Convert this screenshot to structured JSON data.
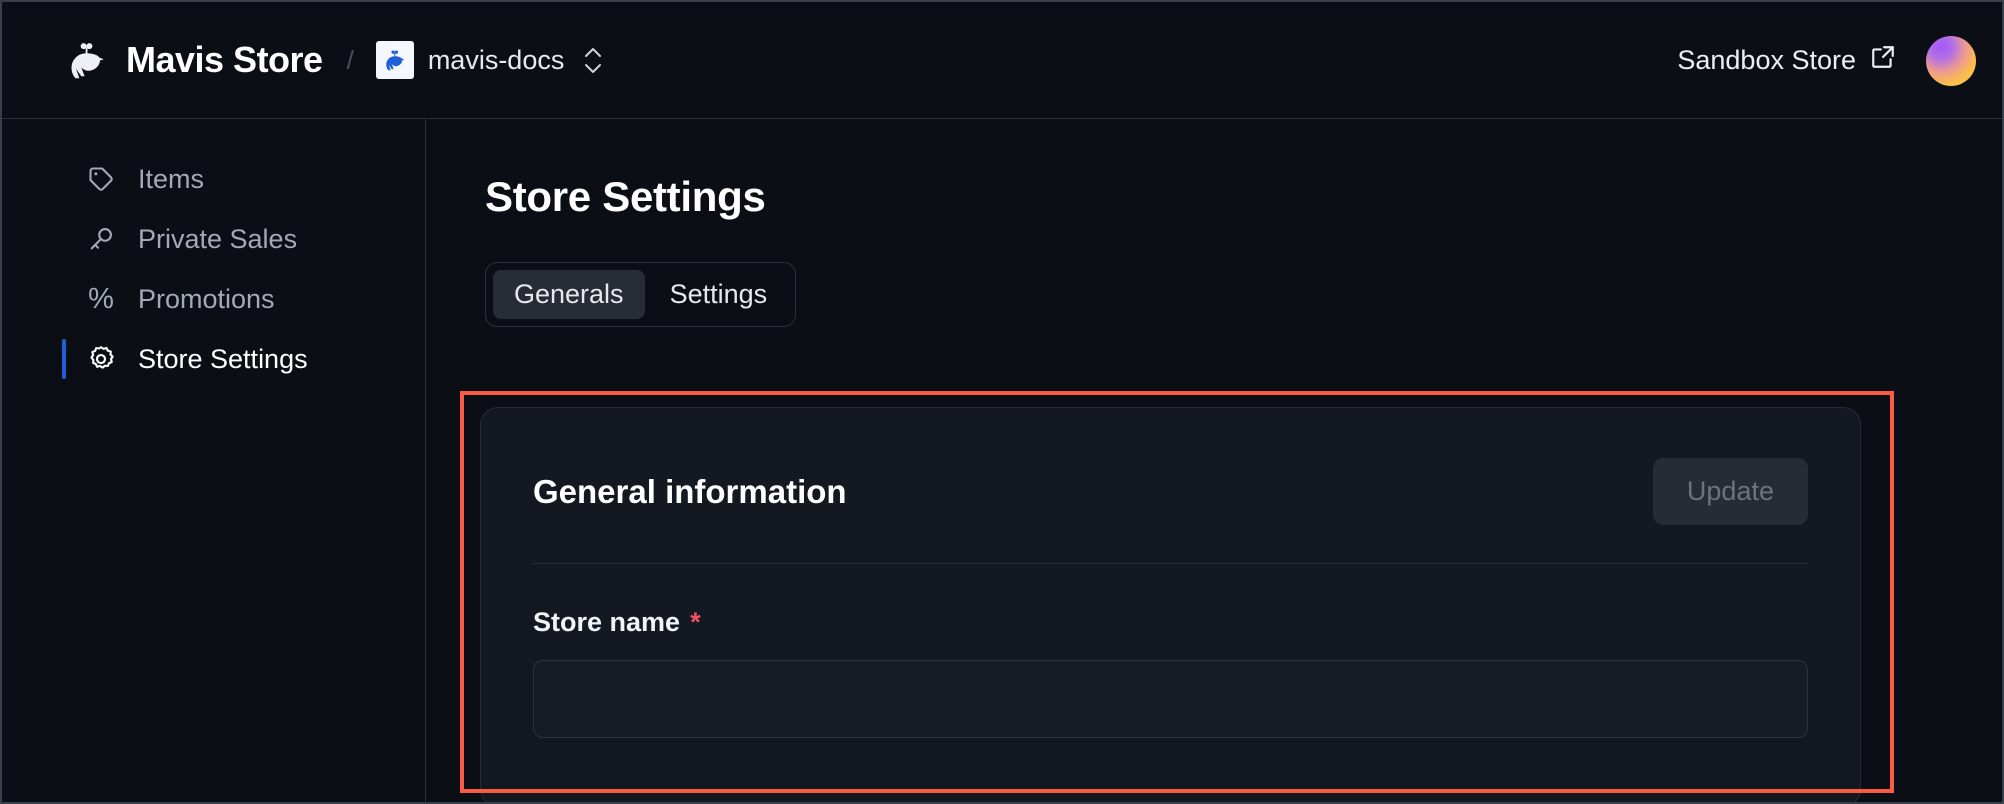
{
  "header": {
    "brand_name": "Mavis Store",
    "separator": "/",
    "store_name": "mavis-docs",
    "sandbox_label": "Sandbox Store"
  },
  "sidebar": {
    "items": [
      {
        "label": "Items",
        "icon": "tag-icon",
        "active": false
      },
      {
        "label": "Private Sales",
        "icon": "key-icon",
        "active": false
      },
      {
        "label": "Promotions",
        "icon": "percent-icon",
        "active": false
      },
      {
        "label": "Store Settings",
        "icon": "gear-icon",
        "active": true
      }
    ]
  },
  "main": {
    "page_title": "Store Settings",
    "tabs": [
      {
        "label": "Generals",
        "active": true
      },
      {
        "label": "Settings",
        "active": false
      }
    ],
    "card": {
      "title": "General information",
      "update_label": "Update",
      "fields": [
        {
          "label": "Store name",
          "required_marker": "*",
          "value": "",
          "placeholder": ""
        }
      ]
    }
  },
  "colors": {
    "page_bg": "#0b0e14",
    "card_bg": "#141821",
    "accent_blue": "#1f5fd8",
    "highlight_red": "#fb5b45",
    "required_red": "#f2516b",
    "text_primary": "#ffffff",
    "text_muted": "#a3a9b5"
  }
}
